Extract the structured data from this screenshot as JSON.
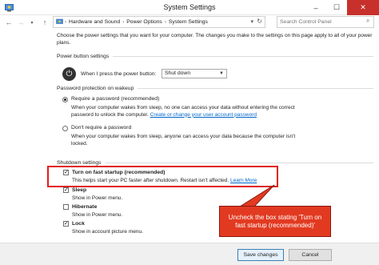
{
  "window": {
    "title": "System Settings",
    "minimize": "–",
    "maximize": "☐",
    "close": "✕"
  },
  "address": {
    "segments": [
      "Hardware and Sound",
      "Power Options",
      "System Settings"
    ],
    "separator": "›",
    "search_placeholder": "Search Control Panel"
  },
  "intro": "Choose the power settings that you want for your computer. The changes you make to the settings on this page apply to all of your power plans.",
  "power_button": {
    "section_title": "Power button settings",
    "label": "When I press the power button:",
    "value": "Shut down"
  },
  "password": {
    "section_title": "Password protection on wakeup",
    "require_label": "Require a password (recommended)",
    "require_desc_1": "When your computer wakes from sleep, no one can access your data without entering the correct",
    "require_desc_2": "password to unlock the computer.",
    "create_link": "Create or change your user account password",
    "no_require_label": "Don't require a password",
    "no_require_desc_1": "When your computer wakes from sleep, anyone can access your data because the computer isn't",
    "no_require_desc_2": "locked."
  },
  "shutdown": {
    "section_title": "Shutdown settings",
    "items": [
      {
        "label": "Turn on fast startup (recommended)",
        "desc": "This helps start your PC faster after shutdown. Restart isn't affected.",
        "link": "Learn More",
        "checked": true
      },
      {
        "label": "Sleep",
        "desc": "Show in Power menu.",
        "checked": true
      },
      {
        "label": "Hibernate",
        "desc": "Show in Power menu.",
        "checked": false
      },
      {
        "label": "Lock",
        "desc": "Show in account picture menu.",
        "checked": true
      }
    ]
  },
  "callout": {
    "line1": "Uncheck the box stating 'Turn on",
    "line2": "fast startup (recommended)'",
    "color": "#e23a21"
  },
  "footer": {
    "save_label": "Save changes",
    "cancel_label": "Cancel"
  }
}
